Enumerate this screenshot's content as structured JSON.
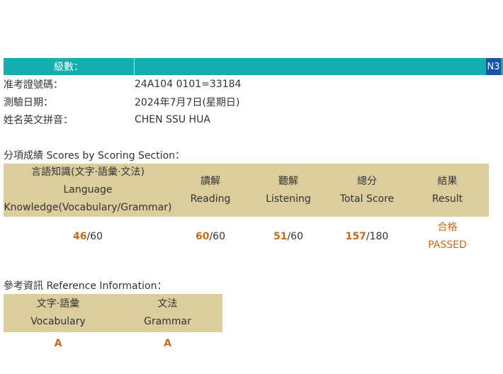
{
  "level": {
    "label": "級數：",
    "value": "N3"
  },
  "info": {
    "exam_no_label": "准考證號碼：",
    "exam_no": "24A104 0101=33184",
    "date_label": "測驗日期：",
    "date": "2024年7月7日(星期日)",
    "name_label": "姓名英文拼音：",
    "name": "CHEN SSU HUA"
  },
  "scores": {
    "title": "分項成績 Scores by Scoring Section：",
    "headers": {
      "language_zh": "言語知識(文字·語彙·文法)",
      "language_en1": "Language",
      "language_en2": "Knowledge(Vocabulary/Grammar)",
      "reading_zh": "讀解",
      "reading_en": "Reading",
      "listening_zh": "聽解",
      "listening_en": "Listening",
      "total_zh": "總分",
      "total_en": "Total Score",
      "result_zh": "結果",
      "result_en": "Result"
    },
    "values": {
      "language": "46",
      "language_max": "/60",
      "reading": "60",
      "reading_max": "/60",
      "listening": "51",
      "listening_max": "/60",
      "total": "157",
      "total_max": "/180",
      "result_zh": "合格",
      "result_en": "PASSED"
    }
  },
  "reference": {
    "title": "參考資訊 Reference Information：",
    "headers": {
      "vocab_zh": "文字·語彙",
      "vocab_en": "Vocabulary",
      "grammar_zh": "文法",
      "grammar_en": "Grammar"
    },
    "values": {
      "vocab": "A",
      "grammar": "A"
    }
  }
}
